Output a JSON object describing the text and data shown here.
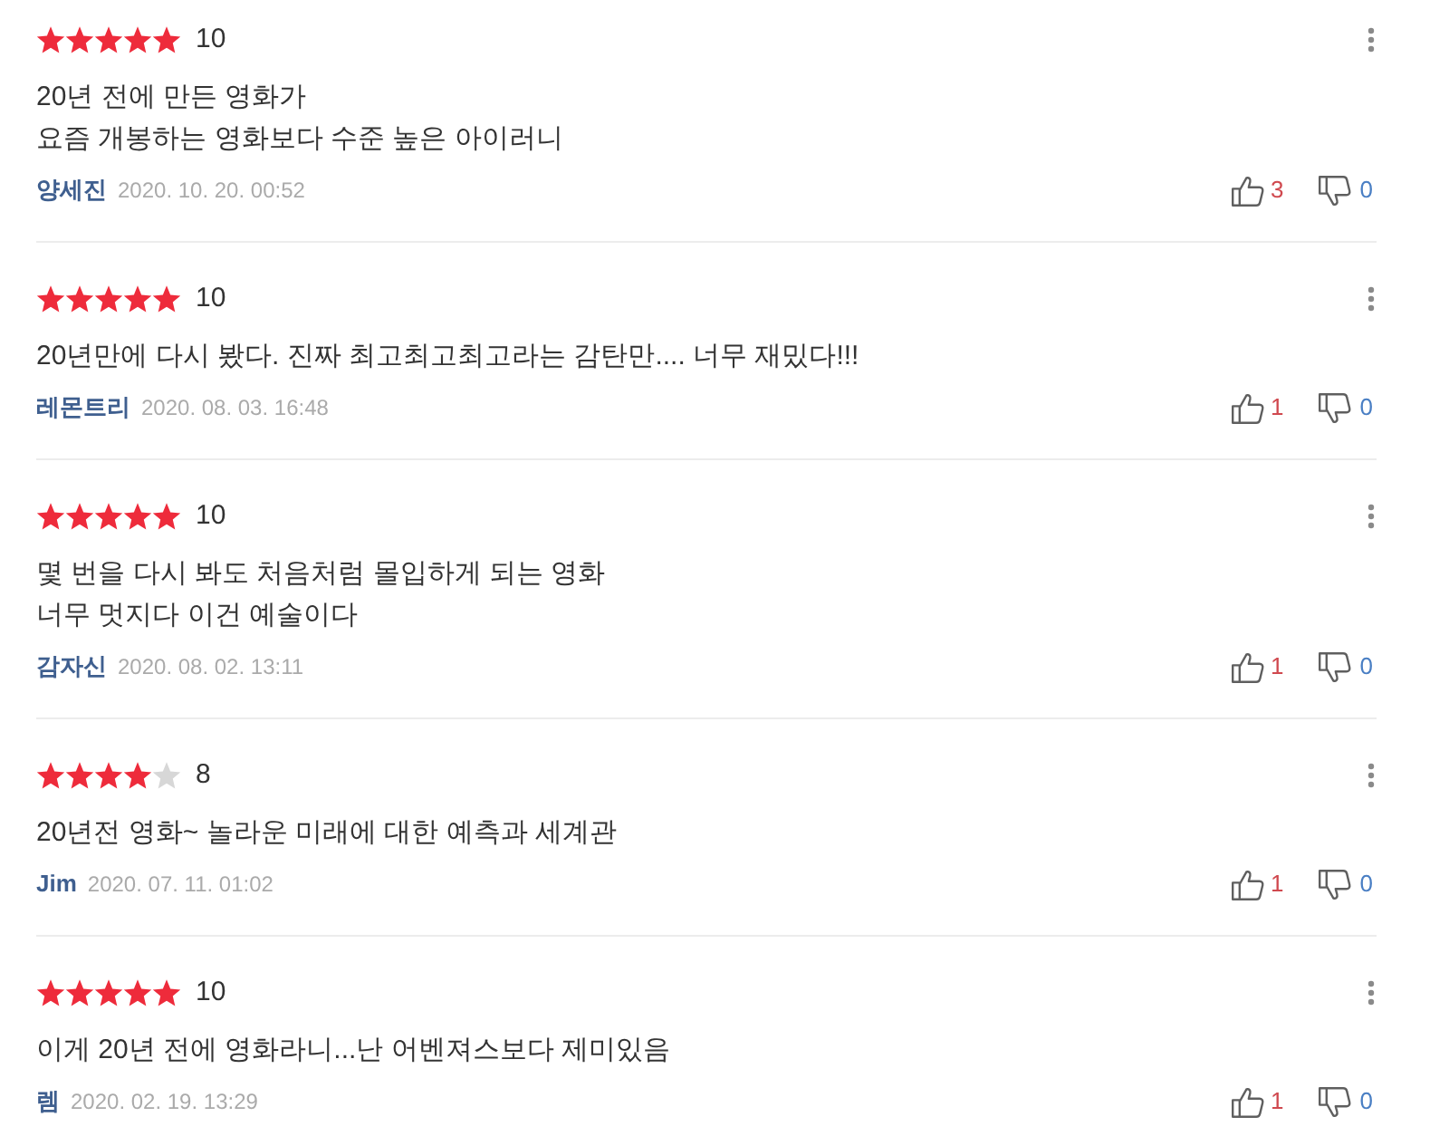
{
  "reviews": [
    {
      "stars": 5,
      "score": "10",
      "comment": "20년 전에 만든 영화가\n요즘 개봉하는 영화보다 수준 높은 아이러니",
      "author": "양세진",
      "date": "2020. 10. 20. 00:52",
      "likes": "3",
      "dislikes": "0"
    },
    {
      "stars": 5,
      "score": "10",
      "comment": "20년만에 다시 봤다. 진짜 최고최고최고라는 감탄만.... 너무 재밌다!!!",
      "author": "레몬트리",
      "date": "2020. 08. 03. 16:48",
      "likes": "1",
      "dislikes": "0"
    },
    {
      "stars": 5,
      "score": "10",
      "comment": "몇 번을 다시 봐도 처음처럼 몰입하게 되는 영화\n너무 멋지다 이건 예술이다",
      "author": "감자신",
      "date": "2020. 08. 02. 13:11",
      "likes": "1",
      "dislikes": "0"
    },
    {
      "stars": 4,
      "score": "8",
      "comment": "20년전 영화~ 놀라운 미래에 대한 예측과 세계관",
      "author": "Jim",
      "date": "2020. 07. 11. 01:02",
      "likes": "1",
      "dislikes": "0"
    },
    {
      "stars": 5,
      "score": "10",
      "comment": "이게 20년 전에 영화라니...난 어벤져스보다 제미있음",
      "author": "렘",
      "date": "2020. 02. 19. 13:29",
      "likes": "1",
      "dislikes": "0"
    }
  ]
}
